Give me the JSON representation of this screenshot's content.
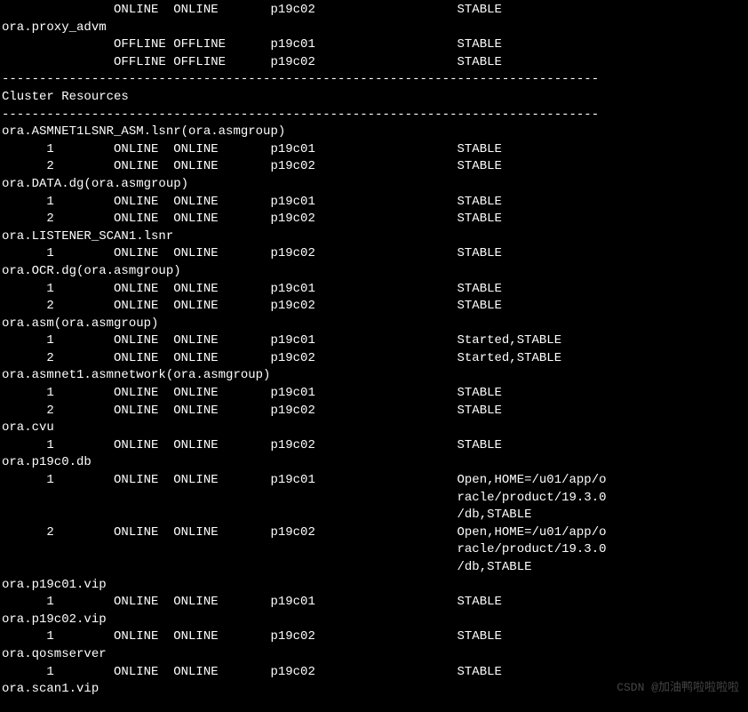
{
  "lines": [
    "               ONLINE  ONLINE       p19c02                   STABLE",
    "ora.proxy_advm",
    "               OFFLINE OFFLINE      p19c01                   STABLE",
    "               OFFLINE OFFLINE      p19c02                   STABLE",
    "--------------------------------------------------------------------------------",
    "Cluster Resources",
    "--------------------------------------------------------------------------------",
    "ora.ASMNET1LSNR_ASM.lsnr(ora.asmgroup)",
    "      1        ONLINE  ONLINE       p19c01                   STABLE",
    "      2        ONLINE  ONLINE       p19c02                   STABLE",
    "ora.DATA.dg(ora.asmgroup)",
    "      1        ONLINE  ONLINE       p19c01                   STABLE",
    "      2        ONLINE  ONLINE       p19c02                   STABLE",
    "ora.LISTENER_SCAN1.lsnr",
    "      1        ONLINE  ONLINE       p19c02                   STABLE",
    "ora.OCR.dg(ora.asmgroup)",
    "      1        ONLINE  ONLINE       p19c01                   STABLE",
    "      2        ONLINE  ONLINE       p19c02                   STABLE",
    "ora.asm(ora.asmgroup)",
    "      1        ONLINE  ONLINE       p19c01                   Started,STABLE",
    "      2        ONLINE  ONLINE       p19c02                   Started,STABLE",
    "ora.asmnet1.asmnetwork(ora.asmgroup)",
    "      1        ONLINE  ONLINE       p19c01                   STABLE",
    "      2        ONLINE  ONLINE       p19c02                   STABLE",
    "ora.cvu",
    "      1        ONLINE  ONLINE       p19c02                   STABLE",
    "ora.p19c0.db",
    "      1        ONLINE  ONLINE       p19c01                   Open,HOME=/u01/app/o",
    "                                                             racle/product/19.3.0",
    "                                                             /db,STABLE",
    "      2        ONLINE  ONLINE       p19c02                   Open,HOME=/u01/app/o",
    "                                                             racle/product/19.3.0",
    "                                                             /db,STABLE",
    "ora.p19c01.vip",
    "      1        ONLINE  ONLINE       p19c01                   STABLE",
    "ora.p19c02.vip",
    "      1        ONLINE  ONLINE       p19c02                   STABLE",
    "ora.qosmserver",
    "      1        ONLINE  ONLINE       p19c02                   STABLE",
    "ora.scan1.vip"
  ],
  "watermark": "CSDN @加油鸭啦啦啦啦"
}
